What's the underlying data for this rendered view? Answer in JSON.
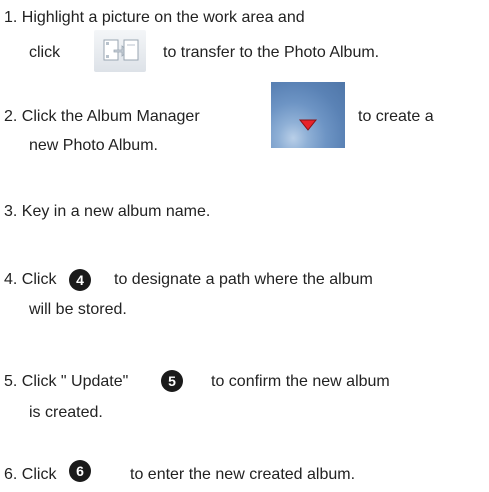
{
  "steps": [
    {
      "line1": "1. Highlight a picture on the work area and",
      "line2_a": "click",
      "line2_b": "to transfer to the Photo Album."
    },
    {
      "line1_a": "2. Click the Album Manager",
      "line1_b": "to create a",
      "line2": "new Photo Album."
    },
    {
      "line1": "3. Key in a new album name."
    },
    {
      "line1_a": "4. Click",
      "badge": "4",
      "line1_b": "to designate a path where the album",
      "line2": "will be stored."
    },
    {
      "line1_a": "5. Click  \" Update\"",
      "badge": "5",
      "line1_b": "to confirm the new album",
      "line2": "is created."
    },
    {
      "line1_a": "6. Click",
      "badge": "6",
      "line1_b": "to enter the new created album."
    }
  ],
  "icons": {
    "transfer": "transfer-to-album-icon",
    "album_manager": "album-manager-dropdown-icon",
    "badge_color": "#1a1a1a",
    "dropdown_arrow_color": "#e8232a"
  }
}
